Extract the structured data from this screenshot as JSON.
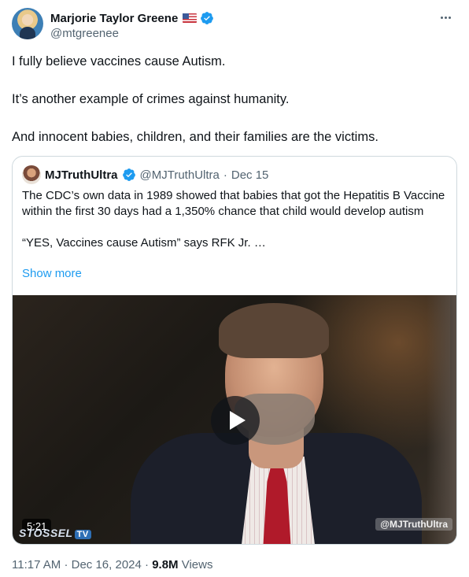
{
  "author": {
    "name": "Marjorie Taylor Greene",
    "handle": "@mtgreenee",
    "flag_icon": "us-flag-icon",
    "verified_icon": "verified-badge-icon",
    "verified_color": "#1d9bf0"
  },
  "tweet": {
    "paragraphs": [
      "I fully believe vaccines cause Autism.",
      "It’s another example of crimes against humanity.",
      "And innocent babies, children, and their families are the victims."
    ]
  },
  "quote": {
    "name": "MJTruthUltra",
    "handle": "@MJTruthUltra",
    "separator": "·",
    "date": "Dec 15",
    "text_1": "The CDC’s own data in 1989 showed that babies that got the Hepatitis B Vaccine within the first 30 days had a 1,350% chance that child would develop autism",
    "text_2": "“YES, Vaccines cause Autism” says RFK Jr. …",
    "show_more": "Show more",
    "video": {
      "duration": "5:21",
      "brand": "STOSSEL",
      "brand_suffix": "TV",
      "watermark": "@MJTruthUltra"
    }
  },
  "meta": {
    "time": "11:17 AM",
    "sep1": "·",
    "date": "Dec 16, 2024",
    "sep2": "·",
    "views_count": "9.8M",
    "views_label": "Views"
  },
  "colors": {
    "text": "#0f1419",
    "secondary": "#536471",
    "link": "#1d9bf0",
    "border": "#cfd9de"
  }
}
